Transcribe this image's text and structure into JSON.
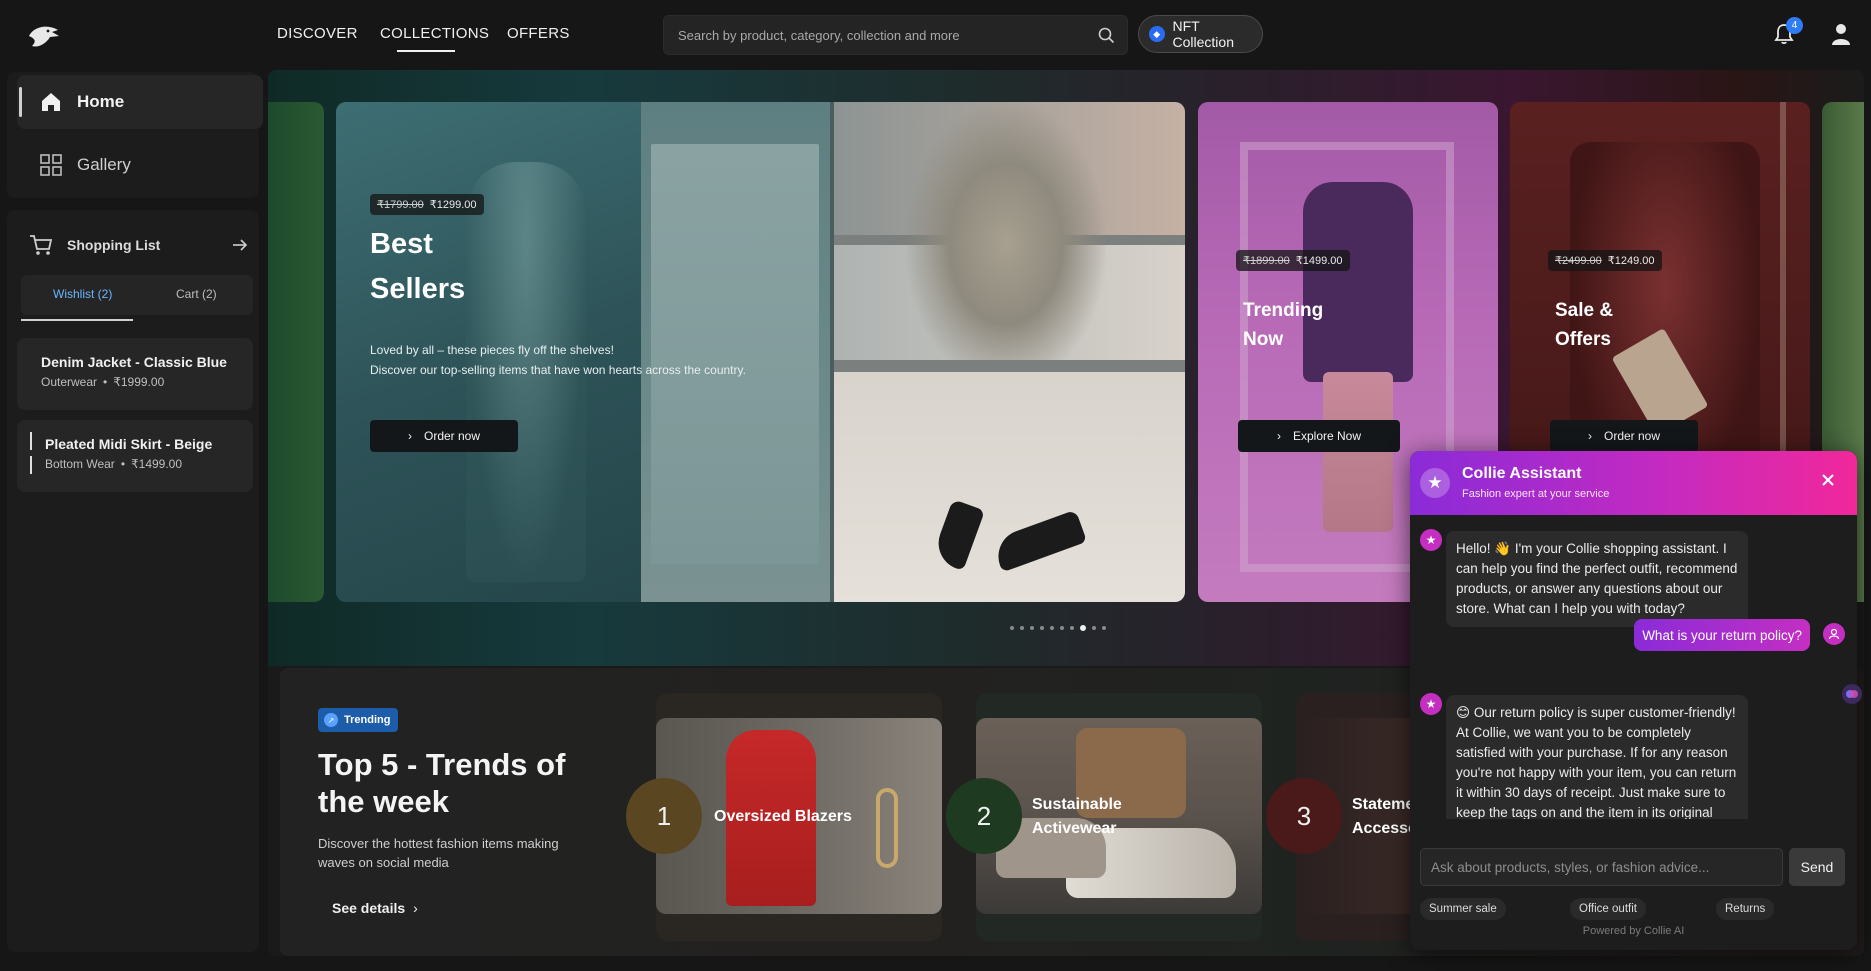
{
  "nav": {
    "links": [
      "DISCOVER",
      "COLLECTIONS",
      "OFFERS"
    ],
    "active": "COLLECTIONS",
    "search_placeholder": "Search by product, category, collection and more",
    "nft_label": "NFT Collection",
    "notification_count": "4"
  },
  "sidebar": {
    "items": [
      {
        "label": "Home",
        "icon": "home-icon"
      },
      {
        "label": "Gallery",
        "icon": "grid-icon"
      }
    ],
    "shopping": {
      "title": "Shopping List",
      "tabs": [
        "Wishlist (2)",
        "Cart (2)"
      ],
      "items": [
        {
          "name": "Denim Jacket - Classic Blue",
          "category": "Outerwear",
          "price": "₹1999.00"
        },
        {
          "name": "Pleated Midi Skirt - Beige",
          "category": "Bottom Wear",
          "price": "₹1499.00"
        }
      ]
    }
  },
  "hero": {
    "main": {
      "old_price": "₹1799.00",
      "price": "₹1299.00",
      "title_line1": "Best",
      "title_line2": "Sellers",
      "desc_line1": "Loved by all – these pieces fly off the shelves!",
      "desc_line2": "Discover our top-selling items that have won hearts across the country.",
      "button": "Order now"
    },
    "trending": {
      "old_price": "₹1899.00",
      "price": "₹1499.00",
      "title_line1": "Trending",
      "title_line2": "Now",
      "button": "Explore Now"
    },
    "sale": {
      "old_price": "₹2499.00",
      "price": "₹1249.00",
      "title_line1": "Sale &",
      "title_line2": "Offers",
      "button": "Order now"
    },
    "dots_count": 10,
    "active_dot": 7
  },
  "trends": {
    "badge": "Trending",
    "title": "Top 5 - Trends of the week",
    "desc": "Discover the hottest fashion items making waves on social media",
    "see_details": "See details",
    "cards": [
      {
        "rank": "1",
        "label_line1": "Oversized Blazers",
        "label_line2": ""
      },
      {
        "rank": "2",
        "label_line1": "Sustainable",
        "label_line2": "Activewear"
      },
      {
        "rank": "3",
        "label_line1": "Stateme",
        "label_line2": "Accesso"
      }
    ]
  },
  "chat": {
    "title": "Collie Assistant",
    "subtitle": "Fashion expert at your service",
    "messages": {
      "bot1": "Hello! 👋 I'm your Collie shopping assistant. I can help you find the perfect outfit, recommend products, or answer any questions about our store. What can I help you with today?",
      "user1": "What is your return policy?",
      "bot2": "😊 Our return policy is super customer-friendly! At Collie, we want you to be completely satisfied with your purchase. If for any reason you're not happy with your item, you can return it within 30 days of receipt. Just make sure to keep the tags on and the item in its original condition. 💯"
    },
    "input_placeholder": "Ask about products, styles, or fashion advice...",
    "send_label": "Send",
    "chips": [
      "Summer sale",
      "Office outfit",
      "Returns"
    ],
    "powered": "Powered by Collie AI"
  },
  "colors": {
    "accent_blue": "#2f7cf6",
    "chat_gradient_start": "#8a2bd8",
    "chat_gradient_end": "#f1289a"
  }
}
